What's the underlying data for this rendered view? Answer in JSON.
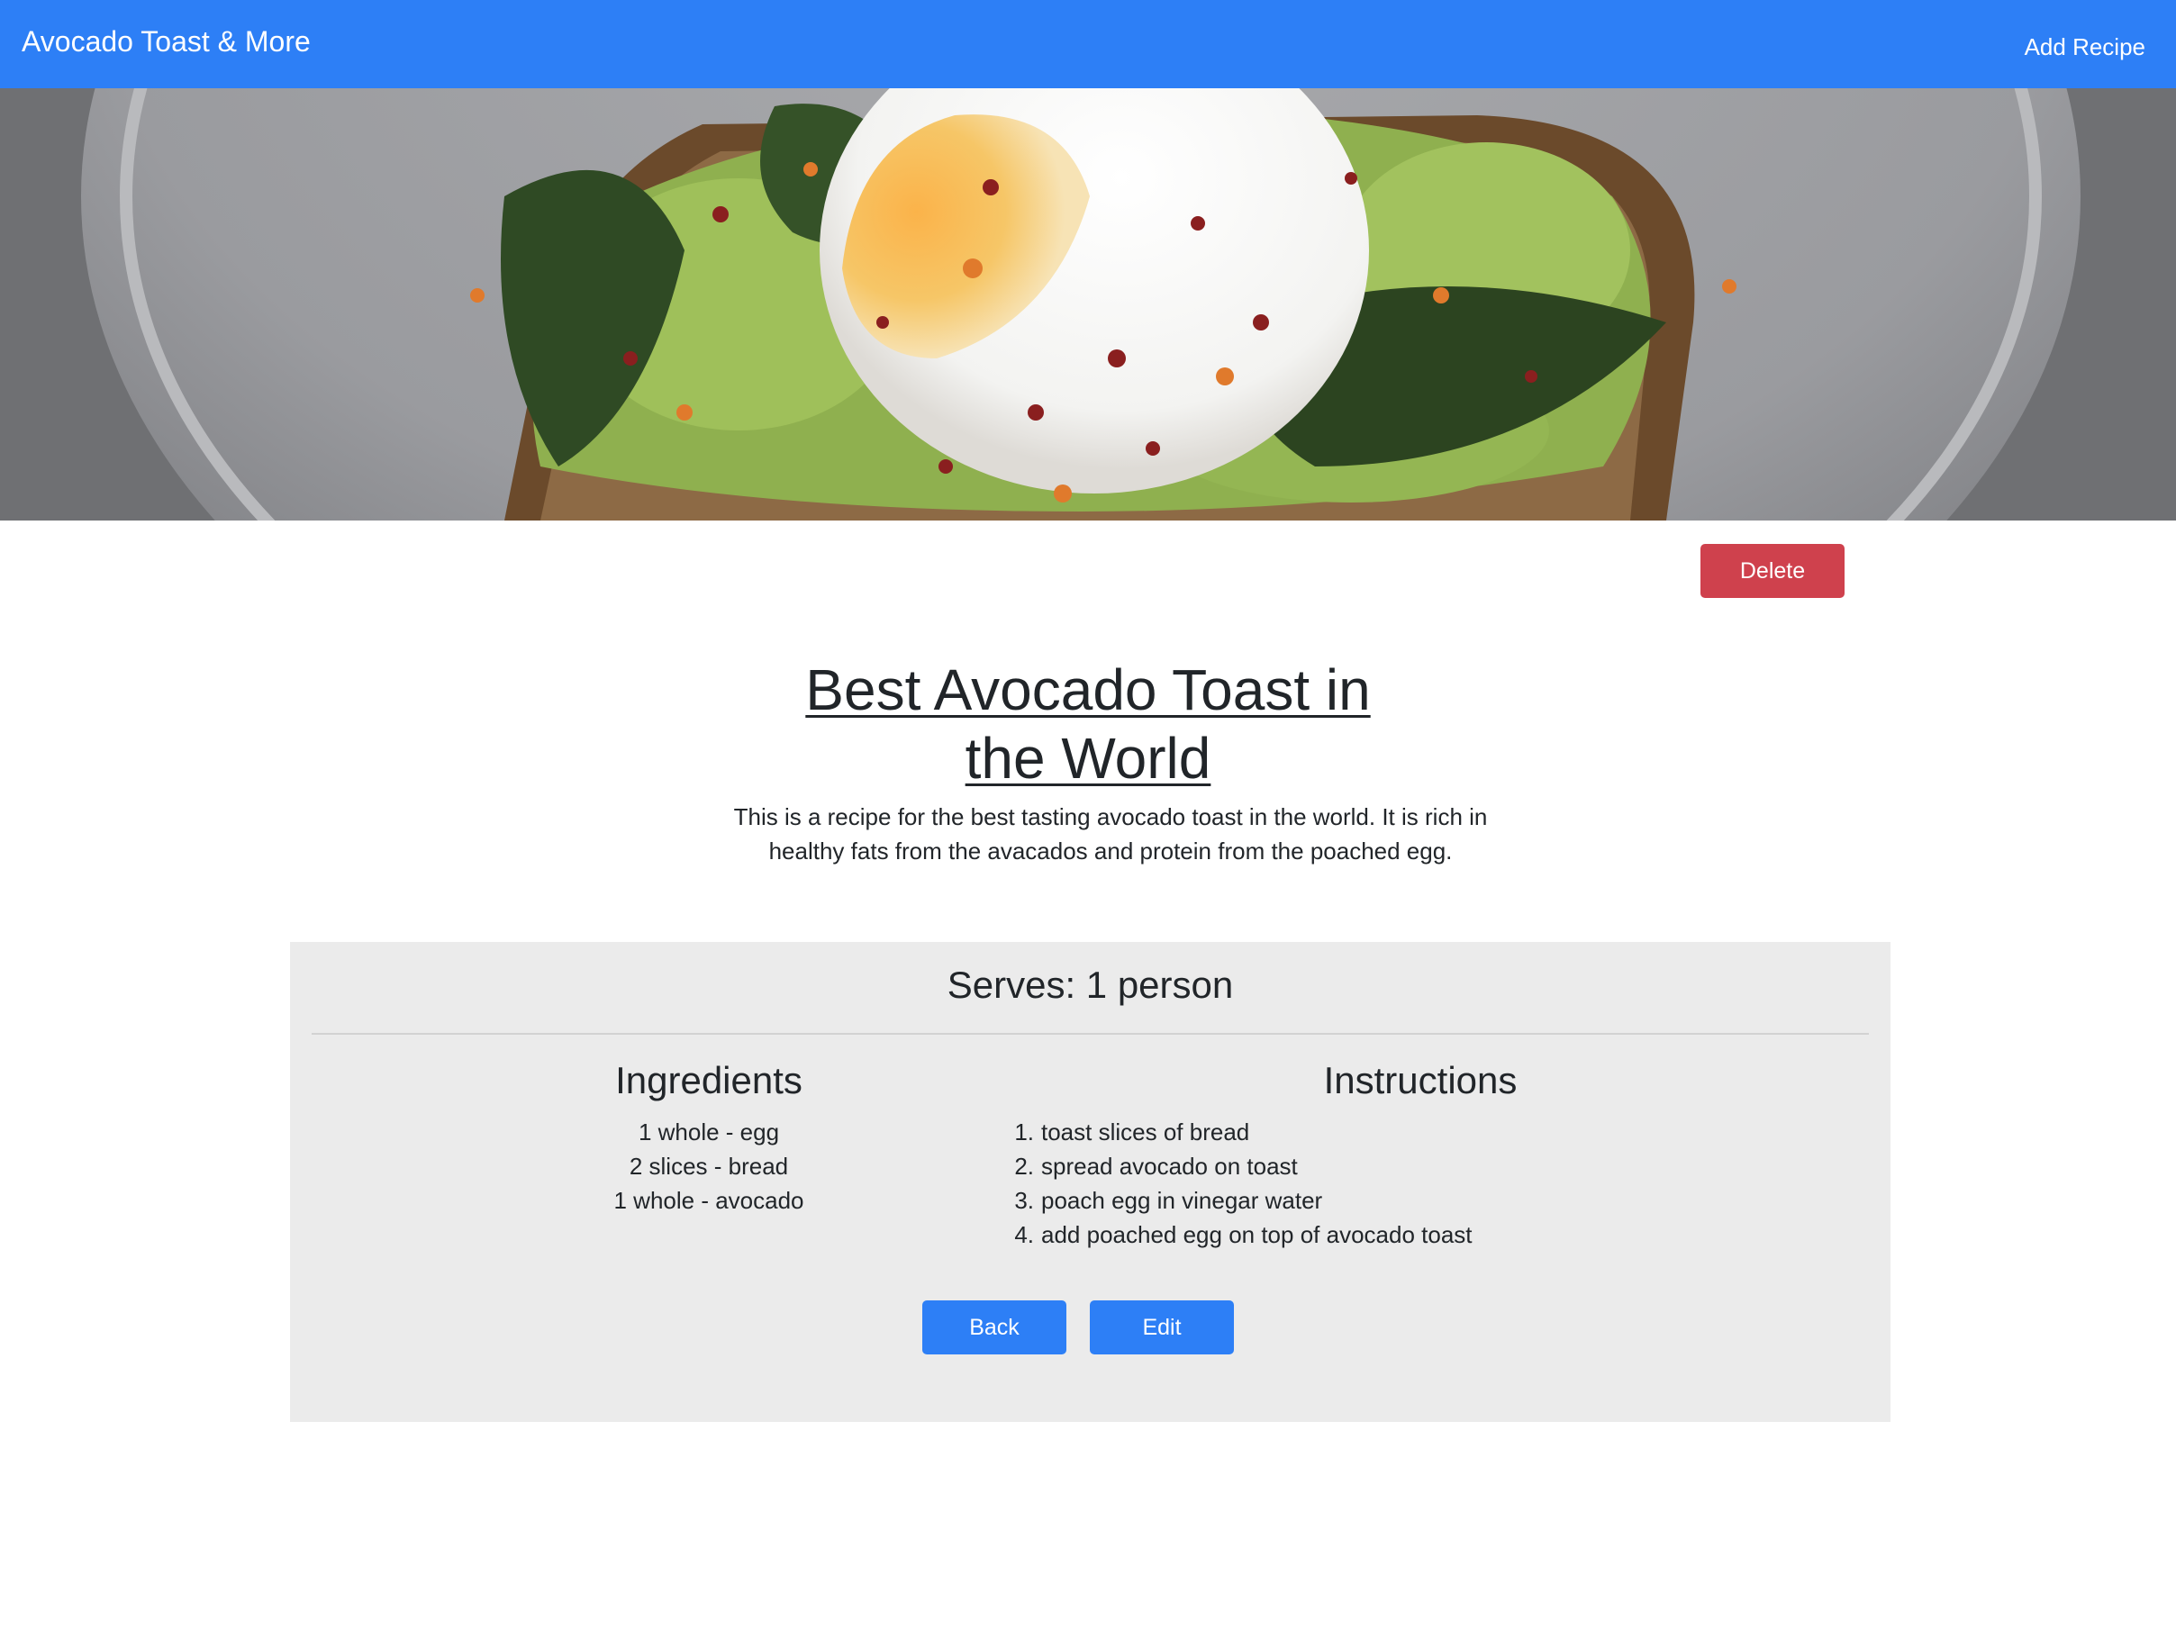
{
  "navbar": {
    "brand": "Avocado Toast & More",
    "add_recipe_label": "Add Recipe",
    "color": "#2d7ff6"
  },
  "hero": {
    "image": "avocado-toast-with-poached-egg-photo"
  },
  "actions": {
    "delete_label": "Delete",
    "delete_color": "#cf414d"
  },
  "recipe": {
    "title": "Best Avocado Toast in the World",
    "description": "This is a recipe for the best tasting avocado toast in the world. It is rich in healthy fats from the avacados and protein from the poached egg.",
    "serves_label": "Serves: 1 person",
    "ingredients_heading": "Ingredients",
    "ingredients": [
      "1 whole - egg",
      "2 slices - bread",
      "1 whole - avocado"
    ],
    "instructions_heading": "Instructions",
    "instructions": [
      {
        "num": "1.",
        "text": "toast slices of bread"
      },
      {
        "num": "2.",
        "text": "spread avocado on toast"
      },
      {
        "num": "3.",
        "text": "poach egg in vinegar water"
      },
      {
        "num": "4.",
        "text": "add poached egg on top of avocado toast"
      }
    ]
  },
  "footer_actions": {
    "back_label": "Back",
    "edit_label": "Edit"
  }
}
